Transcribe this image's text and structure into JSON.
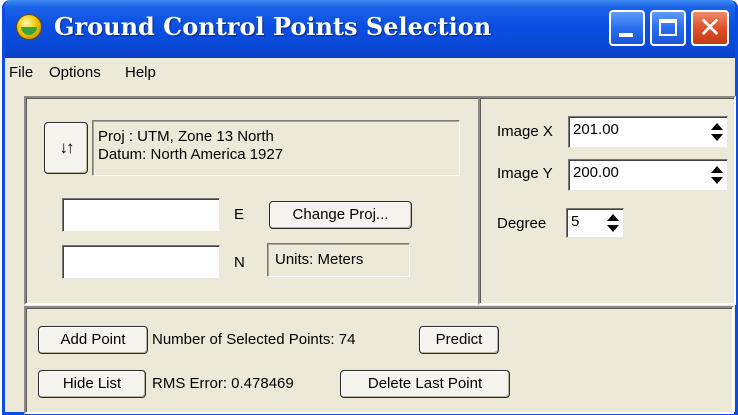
{
  "window": {
    "title": "Ground Control Points Selection",
    "icon": "globe-icon"
  },
  "titlebar_buttons": {
    "minimize_icon": "minimize-icon",
    "maximize_icon": "maximize-icon",
    "close_glyph": "✕"
  },
  "menu": {
    "items": [
      "File",
      "Options",
      "Help"
    ]
  },
  "projection": {
    "swap_glyph": "↓↑",
    "proj_line": "Proj : UTM, Zone 13 North",
    "datum_line": "Datum: North America 1927",
    "e_value": "",
    "e_label": "E",
    "n_value": "",
    "n_label": "N",
    "change_proj_label": "Change Proj...",
    "units_text": "Units: Meters"
  },
  "image_coords": {
    "x_label": "Image X",
    "x_value": "201.00",
    "y_label": "Image Y",
    "y_value": "200.00",
    "degree_label": "Degree",
    "degree_value": "5"
  },
  "points": {
    "add_point_label": "Add Point",
    "selected_points_text": "Number of Selected Points: 74",
    "predict_label": "Predict",
    "hide_list_label": "Hide List",
    "rms_error_text": "RMS Error: 0.478469",
    "delete_last_label": "Delete Last Point"
  },
  "colors": {
    "titlebar": "#0a4ee2",
    "window_bg": "#ece9d8",
    "close_button": "#e0502a"
  }
}
